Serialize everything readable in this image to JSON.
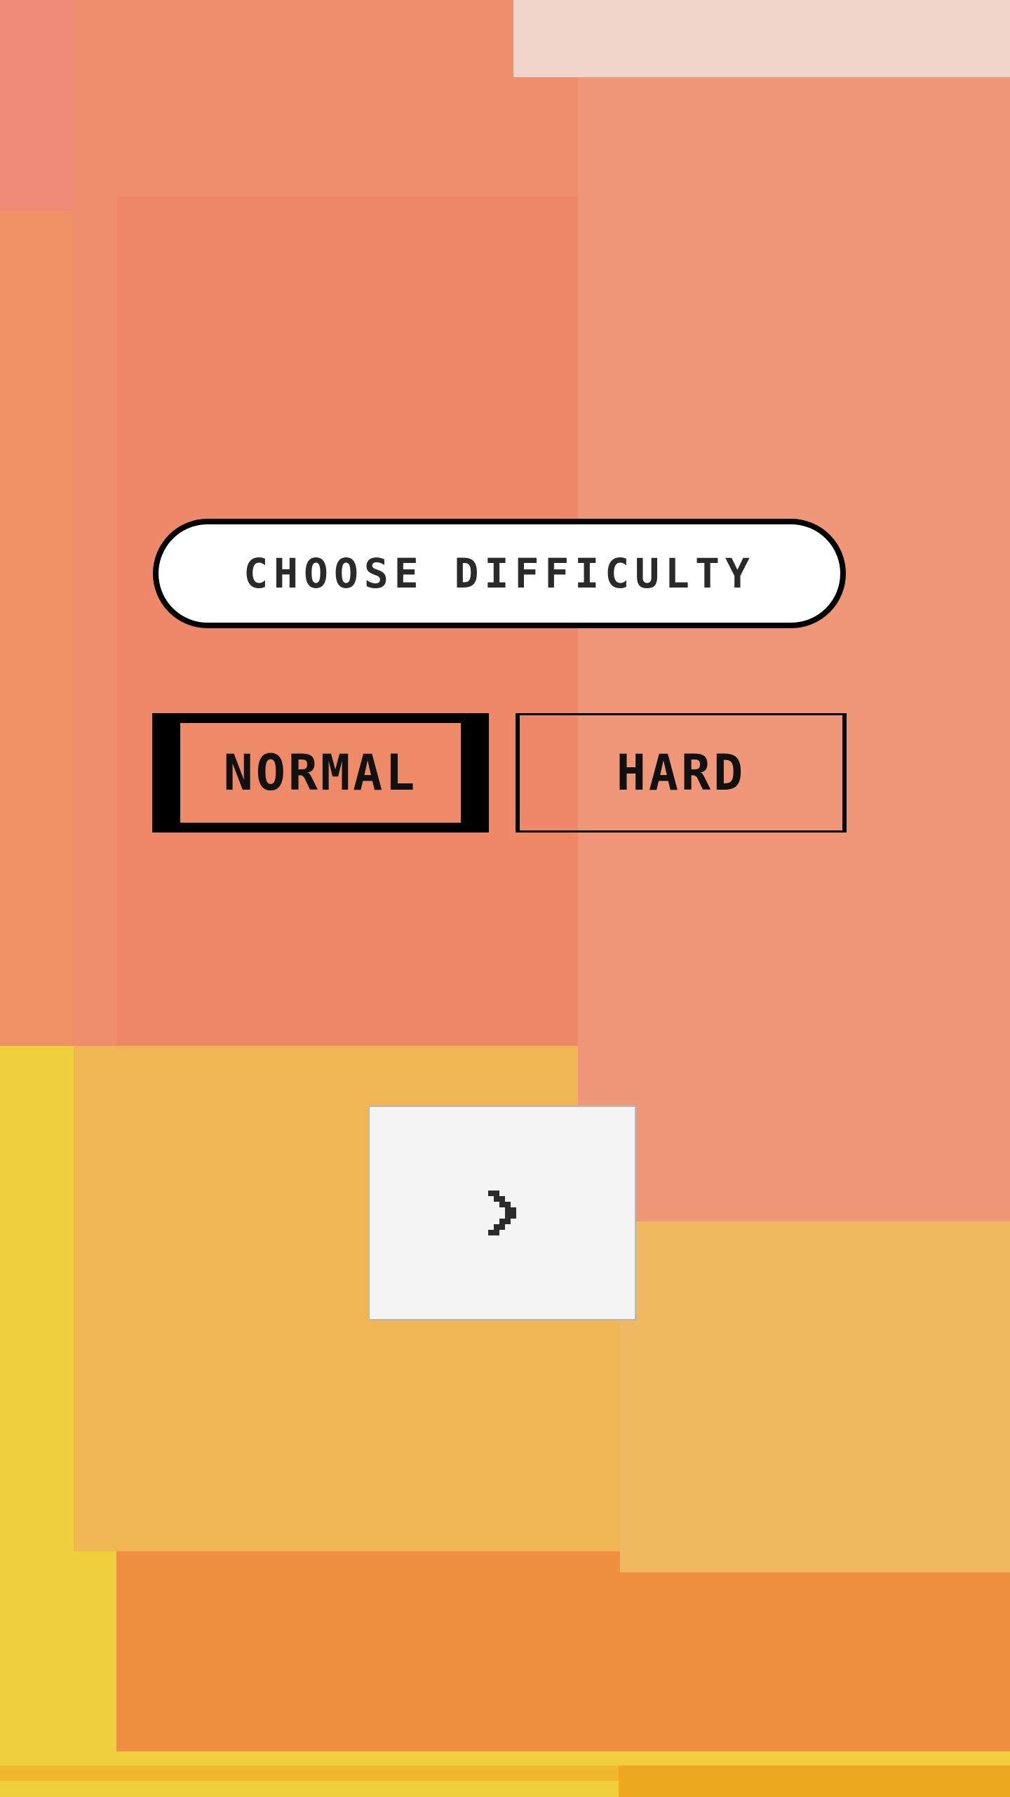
{
  "screen": {
    "title": "CHOOSE DIFFICULTY",
    "options": [
      {
        "label": "NORMAL",
        "selected": true
      },
      {
        "label": "HARD",
        "selected": false
      }
    ],
    "next_icon": "chevron-right-icon"
  },
  "colors": {
    "salmon": "#EF8A68",
    "light_salmon": "#EF9778",
    "orange": "#EE913F",
    "golden": "#F0B655",
    "yellow": "#F0CF3C",
    "panel": "#F4F4F4",
    "ink": "#000000"
  }
}
